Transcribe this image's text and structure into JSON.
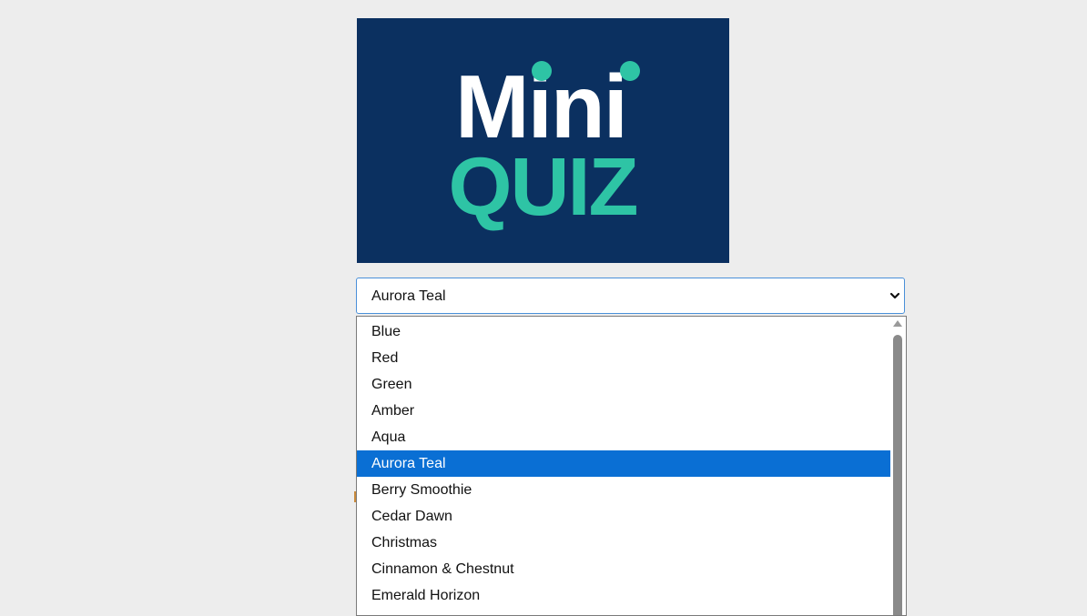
{
  "logo": {
    "line1": "Mini",
    "line2": "QUIZ",
    "background": "#0b3060",
    "line1_color": "#ffffff",
    "line2_color": "#2ec4a5"
  },
  "select": {
    "value": "Aurora Teal",
    "chevron_icon": "chevron-down-icon"
  },
  "dropdown": {
    "options": [
      "Blue",
      "Red",
      "Green",
      "Amber",
      "Aqua",
      "Aurora Teal",
      "Berry Smoothie",
      "Cedar Dawn",
      "Christmas",
      "Cinnamon & Chestnut",
      "Emerald Horizon"
    ],
    "selected_index": 5,
    "highlight_color": "#0a6fd4"
  }
}
